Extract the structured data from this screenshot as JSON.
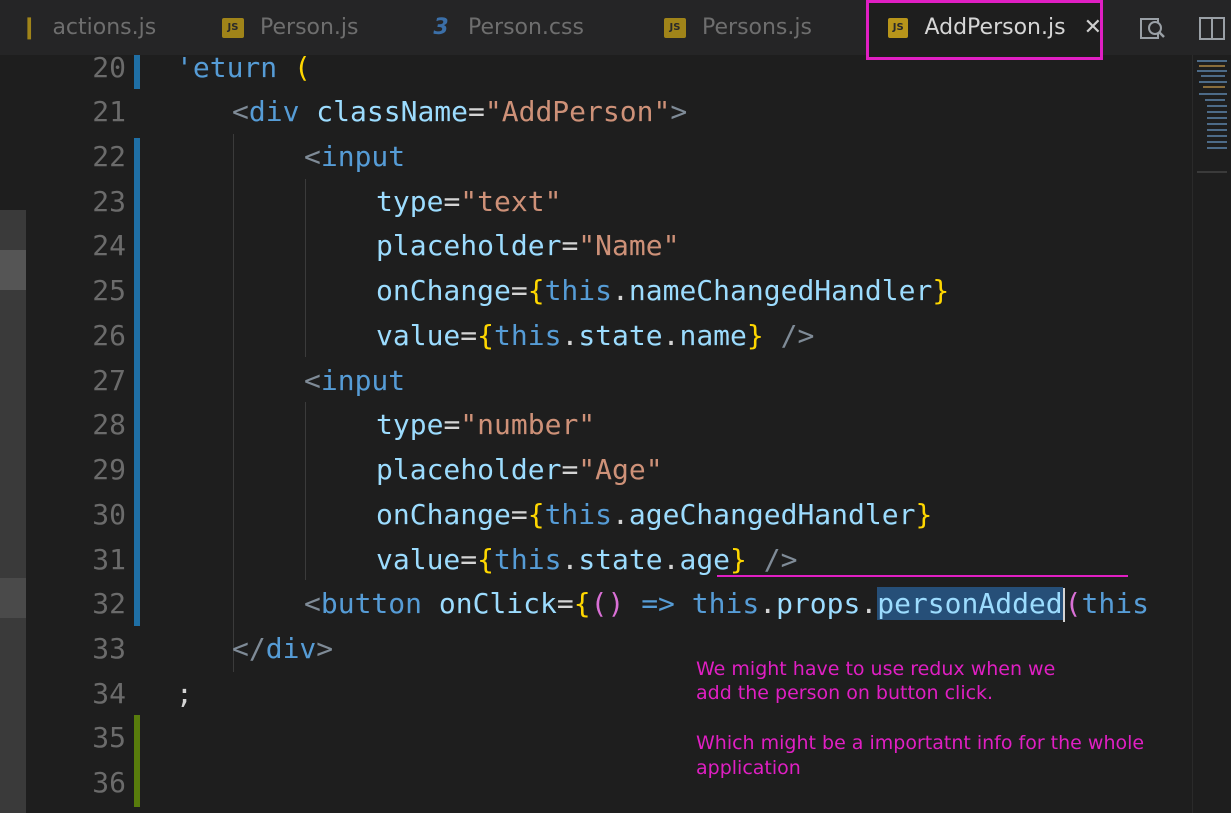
{
  "tabs": [
    {
      "label": "actions.js",
      "icon": "js-file-icon",
      "active": false
    },
    {
      "label": "Person.js",
      "icon": "js-file-icon",
      "active": false
    },
    {
      "label": "Person.css",
      "icon": "css-file-icon",
      "active": false
    },
    {
      "label": "Persons.js",
      "icon": "js-file-icon",
      "active": false
    },
    {
      "label": "AddPerson.js",
      "icon": "js-file-icon",
      "active": true
    }
  ],
  "icon_text": {
    "js": "JS",
    "css": "3",
    "close": "✕"
  },
  "editor": {
    "line_numbers": [
      "20",
      "21",
      "22",
      "23",
      "24",
      "25",
      "26",
      "27",
      "28",
      "29",
      "30",
      "31",
      "32",
      "33",
      "34",
      "35",
      "36"
    ]
  },
  "annotation": {
    "line1": "We might have to use redux when we",
    "line2": "add the person on button click.",
    "line3": "Which might be a importatnt info for the whole",
    "line4": "application",
    "color": "#e01fc3"
  },
  "colors": {
    "background": "#1e1e1e",
    "tabbar": "#252526",
    "highlight": "#e01fc3",
    "selection": "#264f78"
  }
}
